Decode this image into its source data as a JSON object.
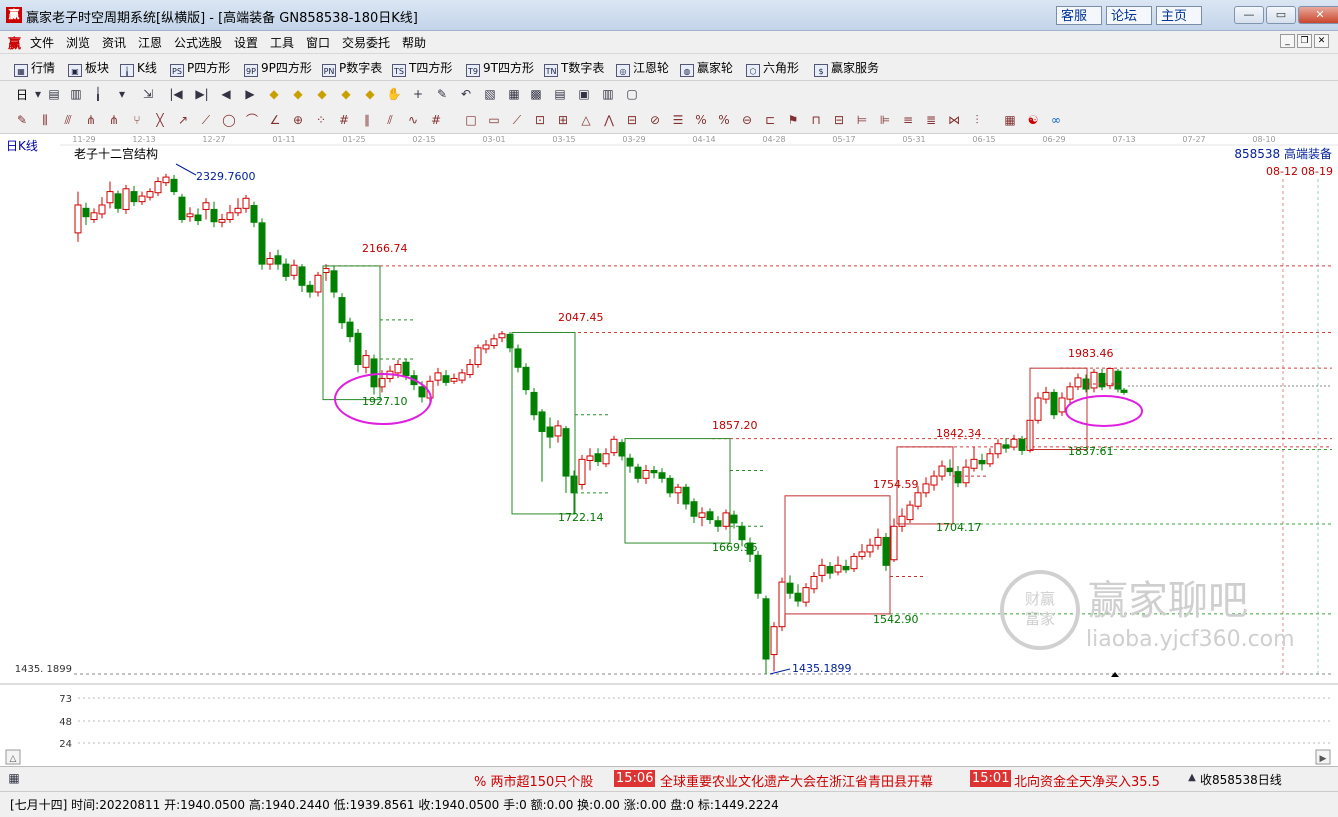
{
  "window": {
    "app_icon": "赢",
    "title": "赢家老子时空周期系统[纵横版] - [高端装备   GN858538-180日K线]",
    "links": [
      "客服",
      "论坛",
      "主页"
    ]
  },
  "menu": {
    "logo": "赢",
    "items": [
      "文件",
      "浏览",
      "资讯",
      "江恩",
      "公式选股",
      "设置",
      "工具",
      "窗口",
      "交易委托",
      "帮助"
    ]
  },
  "toolbar1": {
    "items": [
      {
        "icon": "grid-icon",
        "glyph": "▦",
        "label": "行情"
      },
      {
        "icon": "blocks-icon",
        "glyph": "▣",
        "label": "板块"
      },
      {
        "icon": "candlestick-icon",
        "glyph": "╽",
        "label": "K线"
      },
      {
        "icon": "ps-icon",
        "glyph": "PS",
        "label": "P四方形"
      },
      {
        "icon": "9ps-icon",
        "glyph": "9P",
        "label": "9P四方形"
      },
      {
        "icon": "pn-icon",
        "glyph": "PN",
        "label": "P数字表"
      },
      {
        "icon": "ts-icon",
        "glyph": "TS",
        "label": "T四方形"
      },
      {
        "icon": "t9-icon",
        "glyph": "T9",
        "label": "9T四方形"
      },
      {
        "icon": "tn-icon",
        "glyph": "TN",
        "label": "T数字表"
      },
      {
        "icon": "wheel-icon",
        "glyph": "◎",
        "label": "江恩轮"
      },
      {
        "icon": "bigwheel-icon",
        "glyph": "◍",
        "label": "赢家轮"
      },
      {
        "icon": "hexagon-icon",
        "glyph": "⬡",
        "label": "六角形"
      },
      {
        "icon": "dollar-icon",
        "glyph": "$",
        "label": "赢家服务"
      }
    ]
  },
  "toolbar2": {
    "period_label": "日",
    "icons": [
      "chart-type-icon",
      "stats-icon",
      "chart-style-icon",
      "candle-mode-icon",
      "indicator-icon",
      "drag-icon",
      "first-icon",
      "last-icon",
      "prev-icon",
      "next-icon",
      "diamond-1-icon",
      "diamond-2-icon",
      "diamond-3-icon",
      "diamond-4-icon",
      "diamond-5-icon",
      "hand-icon",
      "crosshair-icon",
      "pencil-icon",
      "undo-icon",
      "save-icon",
      "calendar-icon",
      "calc-icon",
      "page-icon",
      "disk-icon",
      "print-icon",
      "device-icon"
    ],
    "glyphs": [
      "▾",
      "▤",
      "▥",
      "╽",
      "▾",
      "⇲",
      "|◀",
      "▶|",
      "◀",
      "▶",
      "◆",
      "◆",
      "◆",
      "◆",
      "◆",
      "✋",
      "+",
      "✎",
      "↶",
      "▧",
      "▦",
      "▩",
      "▤",
      "▣",
      "▥",
      "▢"
    ]
  },
  "toolbar3": {
    "icons": [
      "draw-pen-icon",
      "line-h1-icon",
      "line-h2-icon",
      "line-h3-icon",
      "line-h4-icon",
      "fork-icon",
      "cross-line-icon",
      "ray-icon",
      "fan-icon",
      "circle-icon",
      "arc-icon",
      "angle-icon",
      "target-icon",
      "dots-icon",
      "grid-lines-icon",
      "parallel-icon",
      "channel-icon",
      "cycle-icon",
      "hash-icon",
      "box-icon",
      "rect-icon",
      "gann-fan-icon",
      "gann-box-icon",
      "gann-square-icon",
      "triangle-icon",
      "zigzag-icon",
      "table-icon",
      "stripes-icon",
      "list-icon",
      "percent-icon",
      "percent2-icon",
      "coin-icon",
      "rule-icon",
      "flag-icon",
      "stairs-icon",
      "levels-icon",
      "split-icon",
      "split2-icon",
      "lines-icon",
      "lines2-icon",
      "spread-icon",
      "stack-icon",
      "window-grid-icon",
      "yin-yang-icon",
      "infinity-icon"
    ],
    "glyphs": [
      "✎",
      "⫼",
      "⫻",
      "⋔",
      "⋔",
      "⑂",
      "╳",
      "↗",
      "⟋",
      "◯",
      "⌒",
      "∠",
      "⊕",
      "⁘",
      "#",
      "∥",
      "⫽",
      "∿",
      "#",
      "□",
      "▭",
      "⟋",
      "⊡",
      "⊞",
      "△",
      "⋀",
      "⊟",
      "⊘",
      "☰",
      "%",
      "%",
      "⊖",
      "⊏",
      "⚑",
      "⊓",
      "⊟",
      "⊨",
      "⊫",
      "≡",
      "≣",
      "⋈",
      "⫶",
      "▦",
      "☯",
      "∞"
    ]
  },
  "chart": {
    "period_label": "日K线",
    "structure_title": "老子十二宫结构",
    "stock_label": "858538 高端装备",
    "future_dates": [
      "08-12",
      "08-19"
    ],
    "date_labels": [
      "11-29",
      "12-13",
      "12-27",
      "01-11",
      "01-25",
      "02-15",
      "03-01",
      "03-15",
      "03-29",
      "04-14",
      "04-28",
      "05-17",
      "05-31",
      "06-15",
      "06-29",
      "07-13",
      "07-27",
      "08-10"
    ],
    "price_labels": [
      {
        "text": "2329.7600",
        "kind": "pivot-high"
      },
      {
        "text": "2166.74",
        "kind": "high"
      },
      {
        "text": "1927.10",
        "kind": "low"
      },
      {
        "text": "2047.45",
        "kind": "high"
      },
      {
        "text": "1722.14",
        "kind": "low"
      },
      {
        "text": "1857.20",
        "kind": "high"
      },
      {
        "text": "1669.96",
        "kind": "low"
      },
      {
        "text": "1754.59",
        "kind": "high"
      },
      {
        "text": "1542.90",
        "kind": "low"
      },
      {
        "text": "1842.34",
        "kind": "high"
      },
      {
        "text": "1704.17",
        "kind": "low"
      },
      {
        "text": "1983.46",
        "kind": "high"
      },
      {
        "text": "1837.61",
        "kind": "low"
      },
      {
        "text": "1435.1899",
        "kind": "pivot-low"
      }
    ],
    "axis_min_label": "1435. 1899",
    "volume_ticks": [
      "73",
      "48",
      "24"
    ],
    "watermark_badge": [
      "财赢",
      "富家"
    ],
    "watermark_text": "赢家聊吧",
    "watermark_url": "liaoba.yjcf360.com",
    "colors": {
      "up": "#d00000",
      "down": "#008000",
      "high_label": "#c00000",
      "low_label": "#007700",
      "pivot": "#001e9a",
      "ellipse": "#e020e0"
    }
  },
  "chart_data": {
    "type": "candlestick",
    "title": "老子十二宫结构",
    "series_name": "858538 高端装备",
    "x_labels": [
      "11-29",
      "12-13",
      "12-27",
      "01-11",
      "01-25",
      "02-15",
      "03-01",
      "03-15",
      "03-29",
      "04-14",
      "04-28",
      "05-17",
      "05-31",
      "06-15",
      "06-29",
      "07-13"
    ],
    "pivot_high": 2329.76,
    "pivot_low": 1435.1899,
    "levels": [
      2166.74,
      1927.1,
      2047.45,
      1722.14,
      1857.2,
      1669.96,
      1754.59,
      1542.9,
      1842.34,
      1704.17,
      1983.46,
      1837.61
    ],
    "last_close": 1940.05
  },
  "bottombar": {
    "tickers": [
      {
        "time": "",
        "text": "% 两市超150只个股"
      },
      {
        "time": "15:06",
        "text": "全球重要农业文化遗产大会在浙江省青田县开幕"
      },
      {
        "time": "15:01",
        "text": "北向资金全天净买入35.5"
      }
    ],
    "right_label": "收858538日线"
  },
  "status": {
    "text": "[七月十四] 时间:20220811 开:1940.0500 高:1940.2440 低:1939.8561 收:1940.0500 手:0 额:0.00 换:0.00 涨:0.00 盘:0 标:1449.2224"
  }
}
